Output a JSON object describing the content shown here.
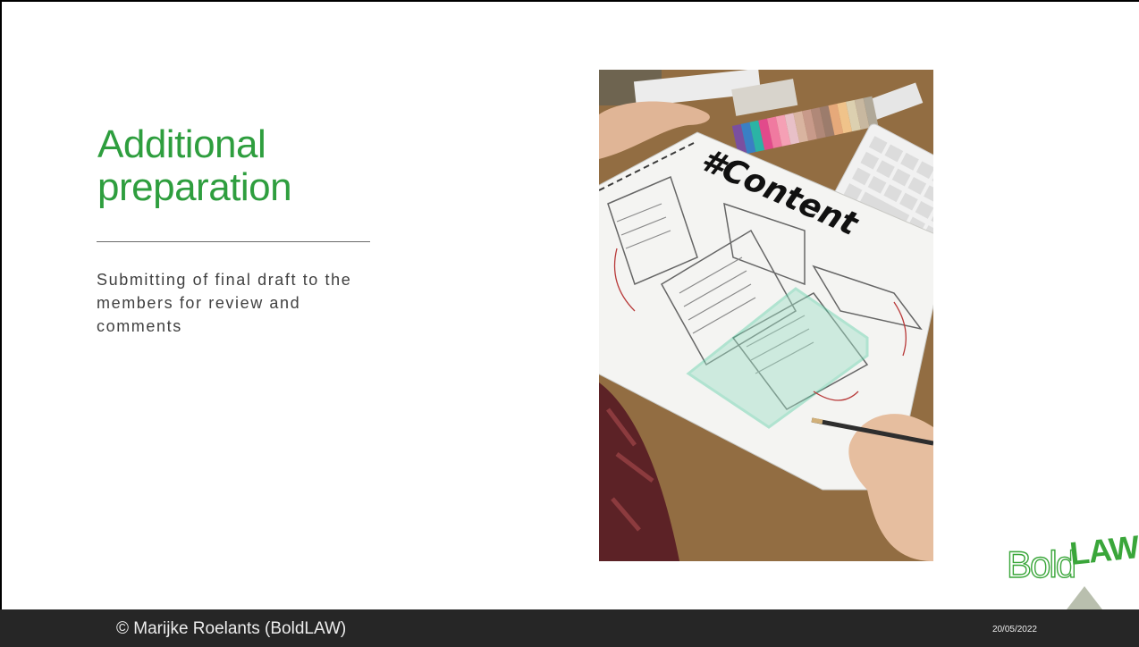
{
  "slide": {
    "title": "Additional preparation",
    "body": "Submitting of final draft to the members for review and comments"
  },
  "photo": {
    "sketch_heading": "#Content"
  },
  "logo": {
    "text_bold": "Bold",
    "text_law": "LAW",
    "green": "#3aa63a",
    "triangle": "#b9bfae"
  },
  "footer": {
    "copyright": "©  Marijke Roelants (BoldLAW)",
    "date": "20/05/2022"
  },
  "colors": {
    "title_green": "#2e9e3e",
    "footer_bg": "#262626"
  }
}
